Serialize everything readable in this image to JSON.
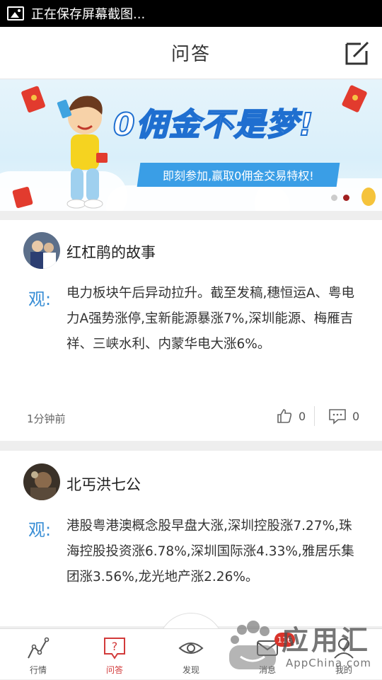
{
  "status_bar": {
    "notification": "正在保存屏幕截图..."
  },
  "header": {
    "title": "问答",
    "edit_icon": "edit-icon"
  },
  "banner": {
    "headline": "0佣金不是梦!",
    "subline": "即刻参加,赢取0佣金交易特权!",
    "colors": {
      "headline_stroke": "#1f6fd0",
      "sub_bg": "#3a9ee6"
    }
  },
  "posts": [
    {
      "author": "红杠鹃的故事",
      "label": "观:",
      "text": "电力板块午后异动拉升。截至发稿,穗恒运A、粤电力A强势涨停,宝新能源暴涨7%,深圳能源、梅雁吉祥、三峡水利、内蒙华电大涨6%。",
      "time": "1分钟前",
      "likes": "0",
      "comments": "0"
    },
    {
      "author": "北丐洪七公",
      "label": "观:",
      "text": "港股粤港澳概念股早盘大涨,深圳控股涨7.27%,珠海控股投资涨6.78%,深圳国际涨4.33%,雅居乐集团涨3.56%,龙光地产涨2.26%。"
    }
  ],
  "tabbar": {
    "tabs": [
      {
        "label": "行情",
        "icon": "chart-line-icon"
      },
      {
        "label": "问答",
        "icon": "question-bubble-icon",
        "active": true
      },
      {
        "label": "发现",
        "icon": "eye-icon"
      },
      {
        "label": "消息",
        "icon": "message-icon",
        "badge": "116"
      },
      {
        "label": "我的",
        "icon": "user-icon"
      }
    ],
    "active_color": "#d23a3a"
  },
  "watermark": {
    "text": "应用汇",
    "sub": "AppChina.com"
  }
}
